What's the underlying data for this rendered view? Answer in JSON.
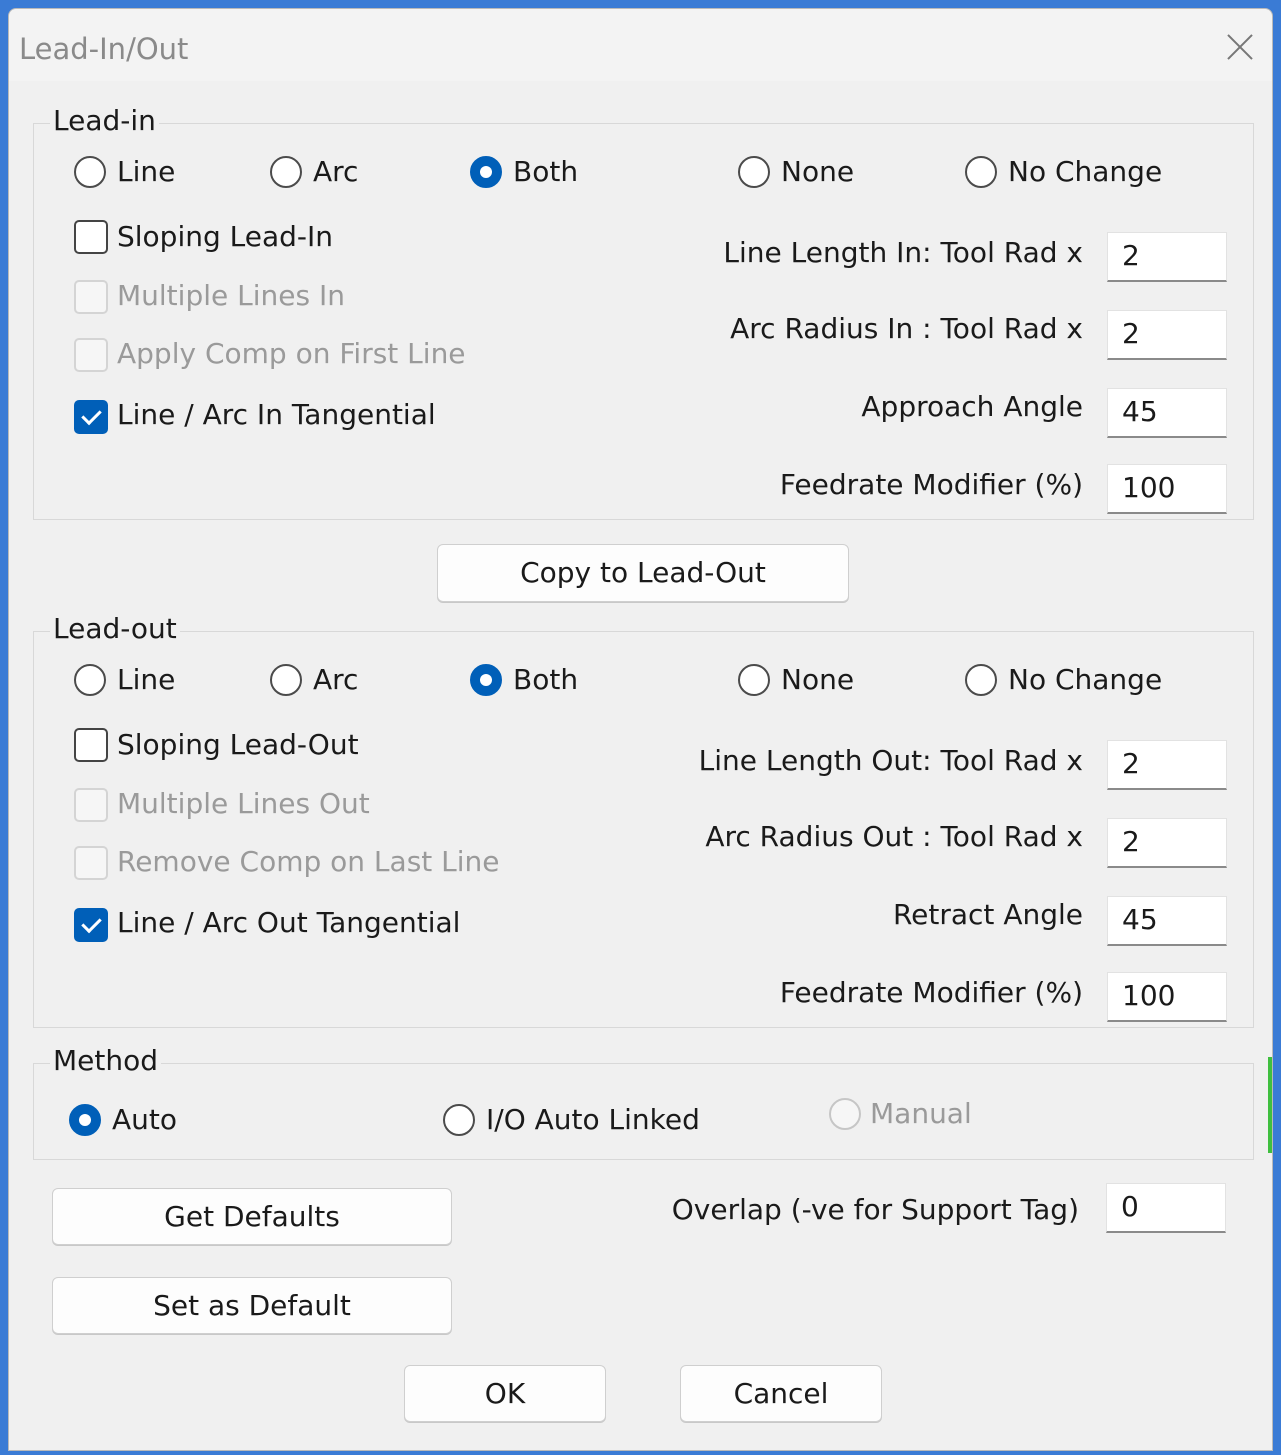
{
  "window": {
    "title": "Lead-In/Out"
  },
  "lead_in": {
    "legend": "Lead-in",
    "radios": [
      "Line",
      "Arc",
      "Both",
      "None",
      "No Change"
    ],
    "selected": "Both",
    "checks": {
      "sloping": "Sloping Lead-In",
      "multiple": "Multiple Lines In",
      "apply_comp": "Apply Comp on First Line",
      "tangential": "Line / Arc In Tangential"
    },
    "fields": {
      "line_length_label": "Line Length In: Tool Rad x",
      "line_length_value": "2",
      "arc_radius_label": "Arc Radius In : Tool Rad x",
      "arc_radius_value": "2",
      "angle_label": "Approach Angle",
      "angle_value": "45",
      "feedrate_label": "Feedrate Modifier (%)",
      "feedrate_value": "100"
    }
  },
  "copy_button": "Copy to Lead-Out",
  "lead_out": {
    "legend": "Lead-out",
    "radios": [
      "Line",
      "Arc",
      "Both",
      "None",
      "No Change"
    ],
    "selected": "Both",
    "checks": {
      "sloping": "Sloping Lead-Out",
      "multiple": "Multiple Lines Out",
      "remove_comp": "Remove Comp on Last Line",
      "tangential": "Line / Arc Out Tangential"
    },
    "fields": {
      "line_length_label": "Line Length Out: Tool Rad x",
      "line_length_value": "2",
      "arc_radius_label": "Arc Radius Out : Tool Rad x",
      "arc_radius_value": "2",
      "angle_label": "Retract Angle",
      "angle_value": "45",
      "feedrate_label": "Feedrate Modifier (%)",
      "feedrate_value": "100"
    }
  },
  "method": {
    "legend": "Method",
    "auto": "Auto",
    "io_auto_linked": "I/O Auto Linked",
    "manual": "Manual",
    "selected": "Auto"
  },
  "overlap": {
    "label": "Overlap (-ve for Support Tag)",
    "value": "0"
  },
  "buttons": {
    "get_defaults": "Get Defaults",
    "set_default": "Set as Default",
    "ok": "OK",
    "cancel": "Cancel"
  },
  "colors": {
    "accent": "#005fb8",
    "disabled_text": "#9a9a9a",
    "dialog_bg": "#f0f0f0"
  }
}
